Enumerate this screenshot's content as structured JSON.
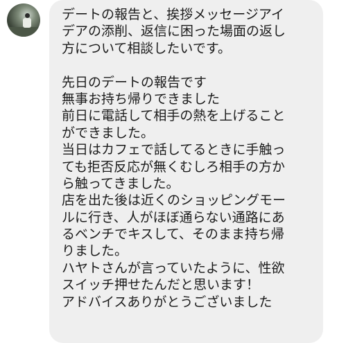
{
  "message": {
    "lines": [
      "デートの報告と、挨拶メッセージアイ",
      "デアの添削、返信に困った場面の返し",
      "方について相談したいです。",
      "",
      "先日のデートの報告です",
      "無事お持ち帰りできました",
      "前日に電話して相手の熱を上げること",
      "ができました。",
      "当日はカフェで話してるときに手触っ",
      "ても拒否反応が無くむしろ相手の方か",
      "ら触ってきました。",
      "店を出た後は近くのショッピングモー",
      "ルに行き、人がほぼ通らない通路にあ",
      "るベンチでキスして、そのまま持ち帰",
      "りました。",
      "ハヤトさんが言っていたように、性欲",
      "スイッチ押せたんだと思います！",
      "アドバイスありがとうございました"
    ]
  }
}
